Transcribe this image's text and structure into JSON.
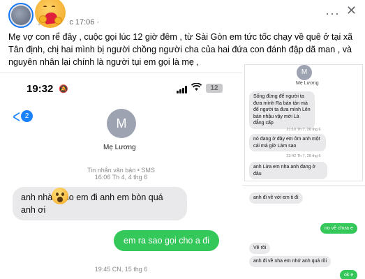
{
  "post": {
    "author": "N",
    "time": "10",
    "time_suffix": "c 17:06 ·",
    "caption": "Mẹ vợ con rể đây , cuộc gọi lúc 12 giờ đêm , từ Sài Gòn em tức tốc chạy về quê ở tại xã Tân định, chị hai mình bị người chồng người cha của hai đứa con đánh đập dã man , và nguyên nhân lại chính là người tụi em gọi là mẹ ,",
    "more_label": "···",
    "close_label": "✕"
  },
  "phone": {
    "time": "19:32",
    "battery": "12",
    "back_badge": "2",
    "contact_initial": "M",
    "contact_name": "Mẹ Lương",
    "service_line1": "Tin nhắn văn bản • SMS",
    "service_line2": "16:06 Th 4, 4 thg 6",
    "messages": {
      "in1": "anh nhà   í cho em đi anh em bòn quá anh ơi",
      "out1": "em ra sao gọi cho a đi"
    },
    "stamp2": "19:45 CN, 15 thg 6"
  },
  "chat_a": {
    "contact_initial": "M",
    "contact_name": "Mẹ Lương",
    "in1": "Sống đừng để người ta đưa mình Ra bàn tán mà để người ta đưa mình Lên bàn nhậu vậy mới Là đẳng cấp",
    "stamp1": "21:10 Th 7, 28 thg 6",
    "in2": "nó đang ở đây em ôm anh một cái mà giờ Làm sao",
    "stamp2": "23:42 Th 7, 28 thg 6",
    "in3": "anh Lừa em nha anh đang ở đâu"
  },
  "chat_b": {
    "in1": "anh đi về với em ti đi",
    "out1": "no về chưa e",
    "in2": "Về rồi",
    "in3": "anh đi về nha em nhớ anh quá rồi",
    "out2": "ok e"
  }
}
